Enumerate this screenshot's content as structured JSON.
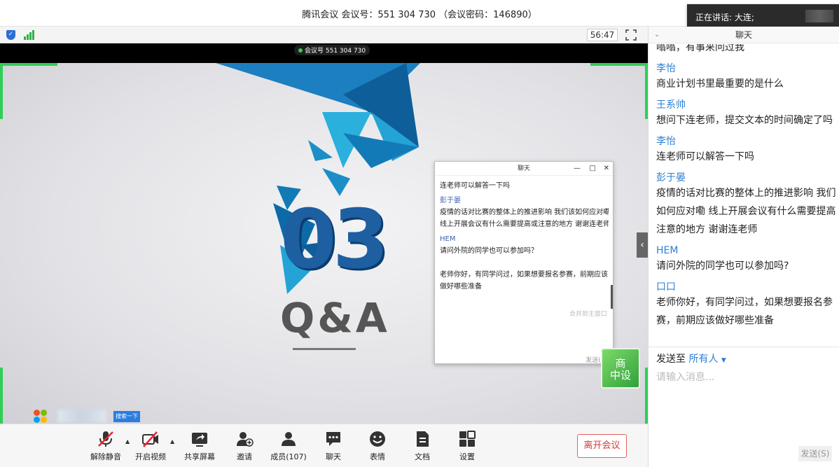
{
  "window": {
    "title": "腾讯会议 会议号：551 304 730 （会议密码：146890）"
  },
  "speaking": {
    "label": "正在讲话: 大连;"
  },
  "video_bar": {
    "timer": "56:47",
    "icons": [
      "shield-icon",
      "signal-icon",
      "fullscreen-icon"
    ]
  },
  "slide": {
    "meeting_tag": "会议号 551 304 730",
    "number": "03",
    "heading": "Q&A",
    "accent_color": "#1d5fa1",
    "frame_color": "#2fcf55"
  },
  "popup_chat": {
    "title": "聊天",
    "controls": [
      "—",
      "□",
      "✕"
    ],
    "lines": [
      {
        "type": "text",
        "text": "连老师可以解答一下吗"
      },
      {
        "type": "name",
        "text": "彭于晏"
      },
      {
        "type": "text",
        "text": "疫情的话对比赛的整体上的推进影响 我们该如何应对嘞"
      },
      {
        "type": "text",
        "text": "线上开展会议有什么需要提高或注意的地方 谢谢连老师"
      },
      {
        "type": "name",
        "text": "HEM"
      },
      {
        "type": "text",
        "text": "请问外院的同学也可以参加吗？"
      },
      {
        "type": "gap",
        "text": ""
      },
      {
        "type": "text",
        "text": "老师你好，有同学问过，如果想要报名参赛，前期应该"
      },
      {
        "type": "text",
        "text": "做好哪些准备"
      }
    ],
    "merge_label": "合并到主窗口",
    "send_label": "发送(S)"
  },
  "corner_logo": {
    "line1": "商",
    "line2": "中设"
  },
  "desktop": {
    "search_label": "搜索一下"
  },
  "toolbar": {
    "buttons": [
      {
        "name": "unmute",
        "label": "解除静音",
        "icon": "mic-off-icon"
      },
      {
        "name": "start-video",
        "label": "开启视频",
        "icon": "video-off-icon"
      },
      {
        "name": "share-screen",
        "label": "共享屏幕",
        "icon": "share-icon"
      },
      {
        "name": "invite",
        "label": "邀请",
        "icon": "add-user-icon"
      },
      {
        "name": "members",
        "label": "成员(107)",
        "icon": "members-icon"
      },
      {
        "name": "chat",
        "label": "聊天",
        "icon": "chat-icon"
      },
      {
        "name": "emoji",
        "label": "表情",
        "icon": "emoji-icon"
      },
      {
        "name": "docs",
        "label": "文档",
        "icon": "doc-icon"
      },
      {
        "name": "settings",
        "label": "设置",
        "icon": "grid-icon"
      }
    ],
    "leave_label": "离开会议",
    "leave_color": "#d83a3a"
  },
  "chat_panel": {
    "title": "聊天",
    "cut_top": "嗡嗡，有事来问过我",
    "messages": [
      {
        "name": "李怡",
        "lines": [
          "商业计划书里最重要的是什么"
        ]
      },
      {
        "name": "王系帅",
        "lines": [
          "想问下连老师，提交文本的时间确定了吗"
        ]
      },
      {
        "name": "李怡",
        "lines": [
          "连老师可以解答一下吗"
        ]
      },
      {
        "name": "彭于晏",
        "lines": [
          "疫情的话对比赛的整体上的推进影响 我们",
          "如何应对嘞 线上开展会议有什么需要提高",
          "注意的地方 谢谢连老师"
        ]
      },
      {
        "name": "HEM",
        "lines": [
          "请问外院的同学也可以参加吗?"
        ]
      },
      {
        "name": "口口",
        "lines": [
          "老师你好，有同学问过，如果想要报名参",
          "赛，前期应该做好哪些准备"
        ]
      }
    ],
    "send_to_label": "发送至",
    "send_to_target": "所有人",
    "input_placeholder": "请输入消息...",
    "send_label": "发送(S)",
    "name_color": "#2c7fd4"
  }
}
